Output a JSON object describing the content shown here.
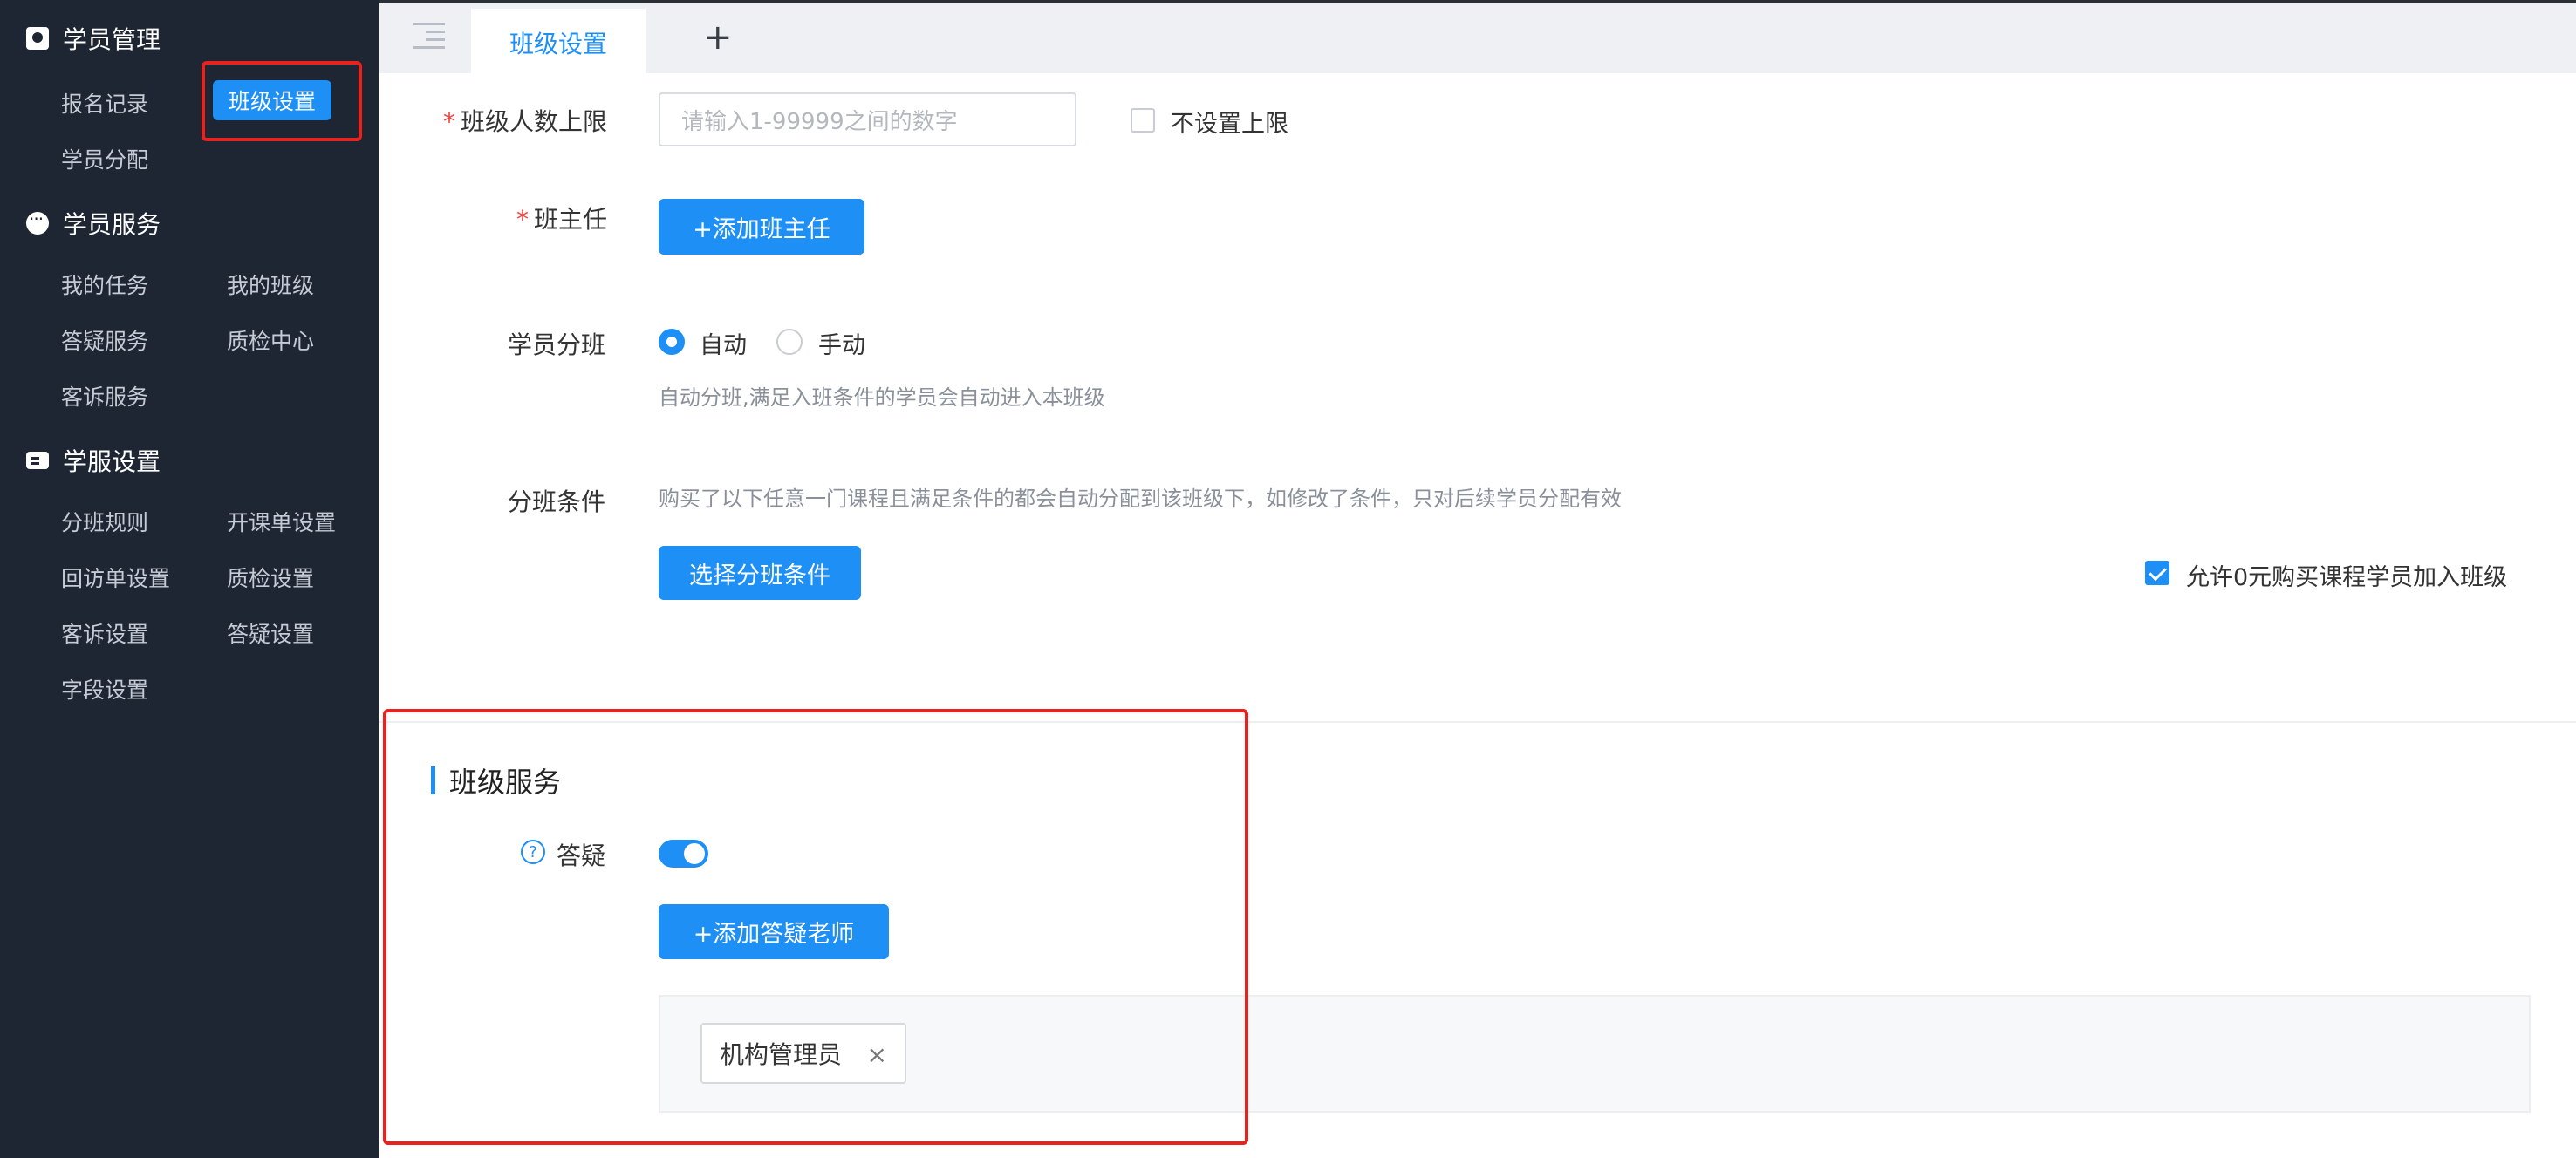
{
  "sidebar": {
    "sections": [
      {
        "title": "学员管理",
        "icon": "contacts-book-icon"
      },
      {
        "title": "学员服务",
        "icon": "chat-bubble-icon"
      },
      {
        "title": "学服设置",
        "icon": "settings-card-icon"
      }
    ],
    "items": {
      "signup_records": "报名记录",
      "class_settings": "班级设置",
      "student_assign": "学员分配",
      "my_tasks": "我的任务",
      "my_classes": "我的班级",
      "qa_service": "答疑服务",
      "qc_center": "质检中心",
      "complaint_service": "客诉服务",
      "split_rules": "分班规则",
      "course_order_settings": "开课单设置",
      "revisit_settings": "回访单设置",
      "qc_settings": "质检设置",
      "complaint_settings": "客诉设置",
      "qa_settings": "答疑设置",
      "field_settings": "字段设置"
    },
    "active_color": "#1e8ff5",
    "background": "#1f2633"
  },
  "tabs": {
    "menu_icon": "menu-collapse-icon",
    "active_tab": "班级设置",
    "add_tab": "+"
  },
  "form": {
    "limit_label": "班级人数上限",
    "required_mark": "*",
    "limit_placeholder": "请输入1-99999之间的数字",
    "no_limit_checkbox": "不设置上限",
    "no_limit_checked": false,
    "head_teacher_label": "班主任",
    "add_head_teacher_button": "+添加班主任",
    "assign_label": "学员分班",
    "assign_options": [
      {
        "label": "自动",
        "selected": true
      },
      {
        "label": "手动",
        "selected": false
      }
    ],
    "assign_hint": "自动分班,满足入班条件的学员会自动进入本班级",
    "condition_label": "分班条件",
    "condition_hint": "购买了以下任意一门课程且满足条件的都会自动分配到该班级下，如修改了条件，只对后续学员分配有效",
    "select_condition_button": "选择分班条件",
    "allow_zero_checkbox": "允许0元购买课程学员加入班级",
    "allow_zero_checked": true
  },
  "class_service": {
    "title": "班级服务",
    "qa_label": "答疑",
    "qa_help": "?",
    "qa_enabled": true,
    "add_qa_teacher_button": "+添加答疑老师",
    "teachers": [
      "机构管理员"
    ],
    "remove_icon": "×"
  }
}
